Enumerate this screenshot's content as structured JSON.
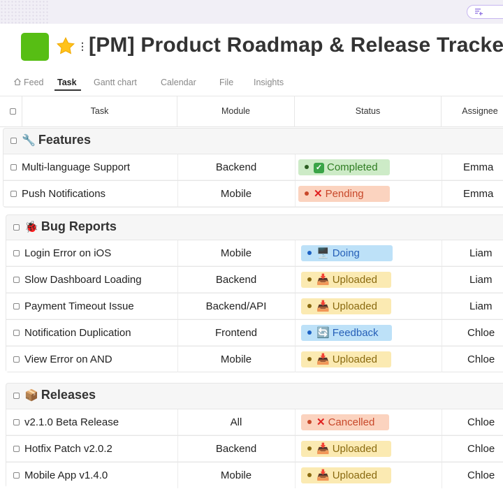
{
  "header": {
    "title": "[PM] Product Roadmap & Release Tracker"
  },
  "tabs": [
    {
      "label": "Feed"
    },
    {
      "label": "Task"
    },
    {
      "label": "Gantt chart"
    },
    {
      "label": "Calendar"
    },
    {
      "label": "File"
    },
    {
      "label": "Insights"
    }
  ],
  "columns": {
    "task": "Task",
    "module": "Module",
    "status": "Status",
    "assignee": "Assignee"
  },
  "groups": [
    {
      "title": "Features",
      "icon": "wrench-icon",
      "rows": [
        {
          "task": "Multi-language Support",
          "module": "Backend",
          "status": "Completed",
          "status_icon": "check-box-icon",
          "assignee": "Emma"
        },
        {
          "task": "Push Notifications",
          "module": "Mobile",
          "status": "Pending",
          "status_icon": "cross-mark-icon",
          "assignee": "Emma"
        }
      ]
    },
    {
      "title": "Bug Reports",
      "icon": "ladybug-icon",
      "rows": [
        {
          "task": "Login Error on iOS",
          "module": "Mobile",
          "status": "Doing",
          "status_icon": "monitor-icon",
          "assignee": "Liam"
        },
        {
          "task": "Slow Dashboard Loading",
          "module": "Backend",
          "status": "Uploaded",
          "status_icon": "inbox-tray-icon",
          "assignee": "Liam"
        },
        {
          "task": "Payment Timeout Issue",
          "module": "Backend/API",
          "status": "Uploaded",
          "status_icon": "inbox-tray-icon",
          "assignee": "Liam"
        },
        {
          "task": "Notification Duplication",
          "module": "Frontend",
          "status": "Feedback",
          "status_icon": "cycle-arrows-icon",
          "assignee": "Chloe"
        },
        {
          "task": "View Error on AND",
          "module": "Mobile",
          "status": "Uploaded",
          "status_icon": "inbox-tray-icon",
          "assignee": "Chloe"
        }
      ]
    },
    {
      "title": "Releases",
      "icon": "package-icon",
      "rows": [
        {
          "task": "v2.1.0 Beta Release",
          "module": "All",
          "status": "Cancelled",
          "status_icon": "cross-mark-icon",
          "assignee": "Chloe"
        },
        {
          "task": "Hotfix Patch v2.0.2",
          "module": "Backend",
          "status": "Uploaded",
          "status_icon": "inbox-tray-icon",
          "assignee": "Chloe"
        },
        {
          "task": "Mobile App v1.4.0",
          "module": "Mobile",
          "status": "Uploaded",
          "status_icon": "inbox-tray-icon",
          "assignee": "Chloe"
        }
      ]
    }
  ],
  "colors": {
    "logo": "#57be14",
    "completed": "#cdebc7",
    "pending": "#fbd3bf",
    "doing": "#bde1f8",
    "uploaded": "#fbeab2"
  }
}
